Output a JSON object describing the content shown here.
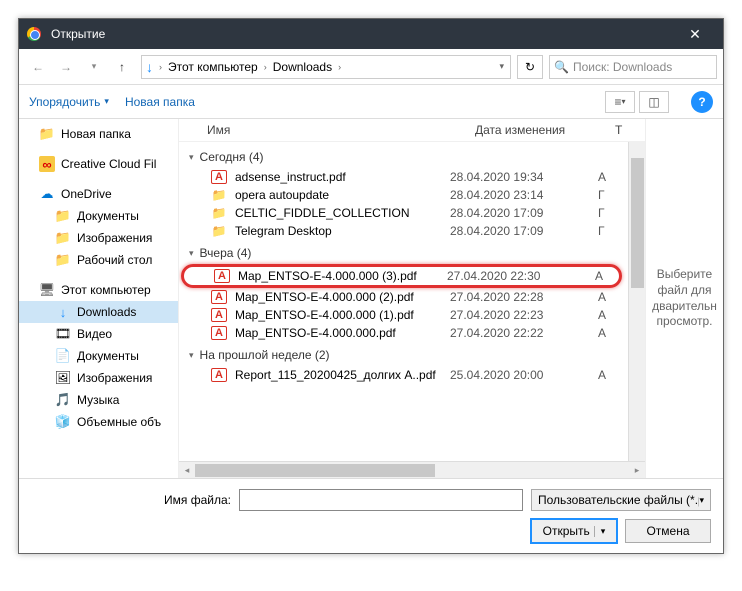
{
  "titlebar": {
    "title": "Открытие"
  },
  "breadcrumb": {
    "seg1": "Этот компьютер",
    "seg2": "Downloads"
  },
  "search": {
    "placeholder": "Поиск: Downloads"
  },
  "toolbar": {
    "organize": "Упорядочить",
    "newfolder": "Новая папка"
  },
  "sidebar": {
    "new_folder": "Новая папка",
    "creative_cloud": "Creative Cloud Fil",
    "onedrive": "OneDrive",
    "documents": "Документы",
    "pictures": "Изображения",
    "desktop": "Рабочий стол",
    "this_pc": "Этот компьютер",
    "downloads": "Downloads",
    "videos": "Видео",
    "documents2": "Документы",
    "pictures2": "Изображения",
    "music": "Музыка",
    "volumes": "Объемные объ"
  },
  "columns": {
    "name": "Имя",
    "date": "Дата изменения",
    "type": "Т"
  },
  "groups": {
    "today": "Сегодня (4)",
    "yesterday": "Вчера (4)",
    "lastweek": "На прошлой неделе (2)"
  },
  "files": {
    "today": [
      {
        "name": "adsense_instruct.pdf",
        "date": "28.04.2020 19:34",
        "type": "A",
        "kind": "pdf"
      },
      {
        "name": "opera autoupdate",
        "date": "28.04.2020 23:14",
        "type": "Г",
        "kind": "folder"
      },
      {
        "name": "CELTIC_FIDDLE_COLLECTION",
        "date": "28.04.2020 17:09",
        "type": "Г",
        "kind": "folder"
      },
      {
        "name": "Telegram Desktop",
        "date": "28.04.2020 17:09",
        "type": "Г",
        "kind": "folder"
      }
    ],
    "yesterday": [
      {
        "name": "Map_ENTSO-E-4.000.000 (3).pdf",
        "date": "27.04.2020 22:30",
        "type": "A",
        "kind": "pdf",
        "hl": true
      },
      {
        "name": "Map_ENTSO-E-4.000.000 (2).pdf",
        "date": "27.04.2020 22:28",
        "type": "A",
        "kind": "pdf"
      },
      {
        "name": "Map_ENTSO-E-4.000.000 (1).pdf",
        "date": "27.04.2020 22:23",
        "type": "A",
        "kind": "pdf"
      },
      {
        "name": "Map_ENTSO-E-4.000.000.pdf",
        "date": "27.04.2020 22:22",
        "type": "A",
        "kind": "pdf"
      }
    ],
    "lastweek": [
      {
        "name": "Report_115_20200425_долгих A..pdf",
        "date": "25.04.2020 20:00",
        "type": "A",
        "kind": "pdf"
      }
    ]
  },
  "preview": {
    "text": "Выберите файл для дварительн просмотр."
  },
  "footer": {
    "filename_label": "Имя файла:",
    "filter": "Пользовательские файлы (*.p",
    "open": "Открыть",
    "cancel": "Отмена"
  }
}
